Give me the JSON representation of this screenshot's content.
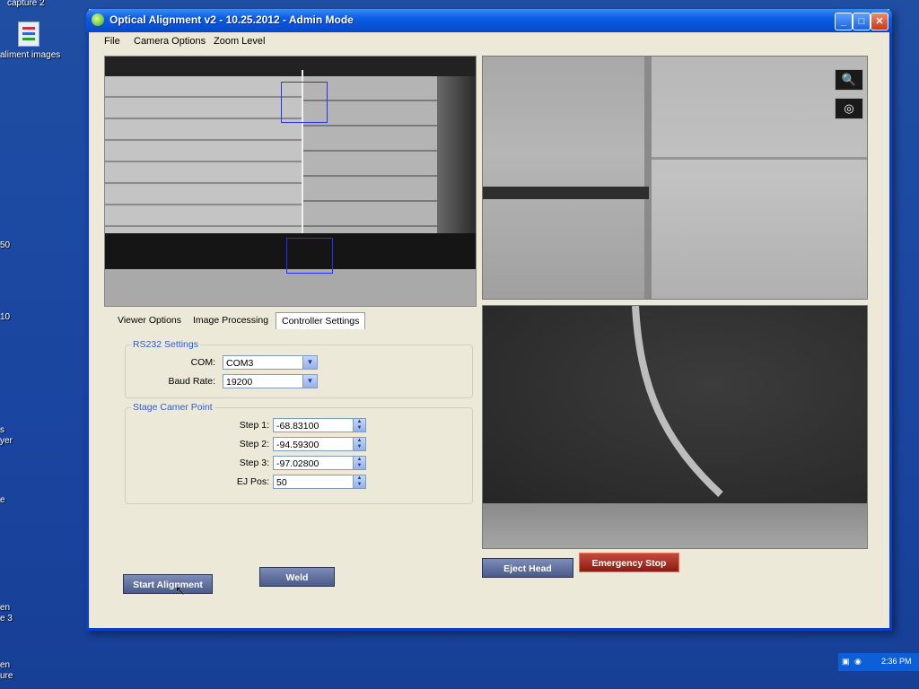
{
  "desktop": {
    "icons": [
      {
        "label": "capture 2"
      },
      {
        "label": "aliment images"
      }
    ],
    "edge_labels": [
      "50",
      "10",
      "s",
      "yer",
      "e",
      "en",
      "e 3",
      "en",
      "ure"
    ]
  },
  "window": {
    "title": "Optical Alignment v2 - 10.25.2012 - Admin Mode",
    "controls": {
      "minimize": "_",
      "maximize": "□",
      "close": "✕"
    }
  },
  "menu": {
    "file": "File",
    "camera_options": "Camera Options",
    "zoom_level": "Zoom Level"
  },
  "tabs": {
    "viewer_options": "Viewer Options",
    "image_processing": "Image Processing",
    "controller_settings": "Controller Settings"
  },
  "rs232": {
    "title": "RS232 Settings",
    "com_label": "COM:",
    "com_value": "COM3",
    "baud_label": "Baud Rate:",
    "baud_value": "19200"
  },
  "stage": {
    "title": "Stage Camer Point",
    "fields": [
      {
        "label": "Step 1:",
        "value": "-68.83100"
      },
      {
        "label": "Step 2:",
        "value": "-94.59300"
      },
      {
        "label": "Step 3:",
        "value": "-97.02800"
      },
      {
        "label": "EJ Pos:",
        "value": "50"
      }
    ]
  },
  "buttons": {
    "start_alignment": "Start Alignment",
    "weld": "Weld",
    "eject_head": "Eject Head",
    "emergency_stop": "Emergency Stop"
  },
  "tray": {
    "time": "2:36 PM"
  },
  "icons": {
    "zoom": "magnifier-plus-icon",
    "target": "target-icon"
  }
}
